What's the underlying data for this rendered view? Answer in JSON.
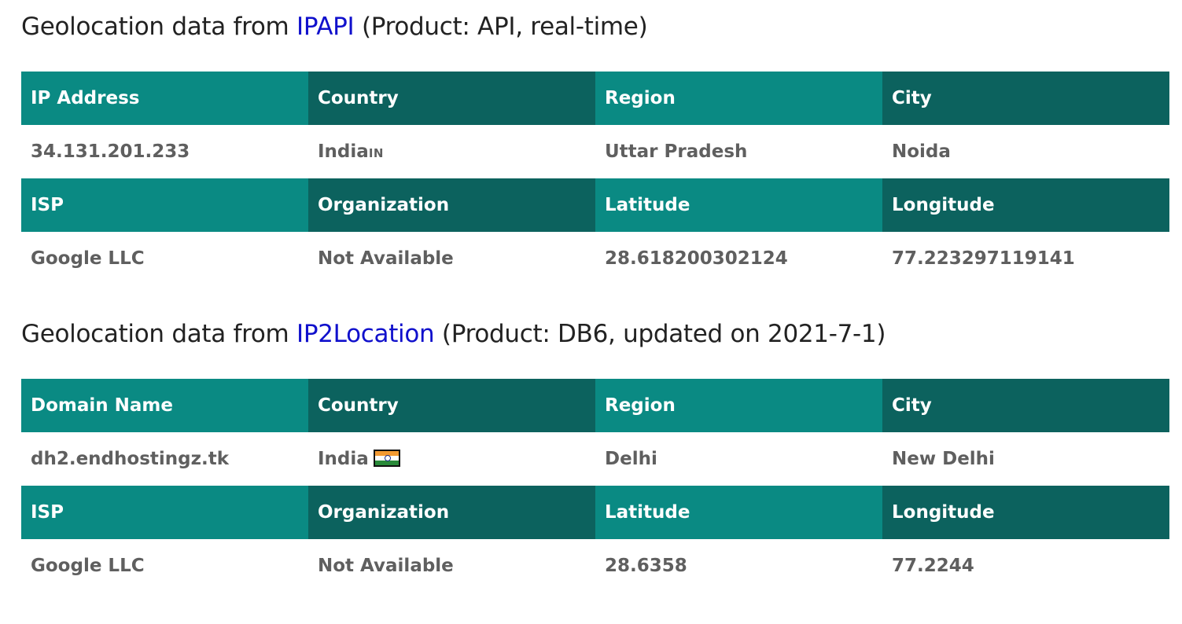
{
  "ipapi": {
    "heading_prefix": "Geolocation data from ",
    "provider_link": "IPAPI",
    "heading_suffix": " (Product: API, real-time)",
    "labels": {
      "col1": "IP Address",
      "country": "Country",
      "region": "Region",
      "city": "City",
      "isp": "ISP",
      "organization": "Organization",
      "latitude": "Latitude",
      "longitude": "Longitude"
    },
    "values": {
      "col1": "34.131.201.233",
      "country": "India",
      "country_code": "IN",
      "region": "Uttar Pradesh",
      "city": "Noida",
      "isp": "Google LLC",
      "organization": "Not Available",
      "latitude": "28.618200302124",
      "longitude": "77.223297119141"
    }
  },
  "ip2location": {
    "heading_prefix": "Geolocation data from ",
    "provider_link": "IP2Location",
    "heading_suffix": " (Product: DB6, updated on 2021-7-1)",
    "labels": {
      "col1": "Domain Name",
      "country": "Country",
      "region": "Region",
      "city": "City",
      "isp": "ISP",
      "organization": "Organization",
      "latitude": "Latitude",
      "longitude": "Longitude"
    },
    "values": {
      "col1": "dh2.endhostingz.tk",
      "country": "India",
      "flag_icon": "india-flag-icon",
      "region": "Delhi",
      "city": "New Delhi",
      "isp": "Google LLC",
      "organization": "Not Available",
      "latitude": "28.6358",
      "longitude": "77.2244"
    }
  },
  "colors": {
    "header_teal": "#0a8a83",
    "header_dark_teal": "#0c625e",
    "link_blue": "#1010cc",
    "value_text": "#5f5f5f"
  }
}
